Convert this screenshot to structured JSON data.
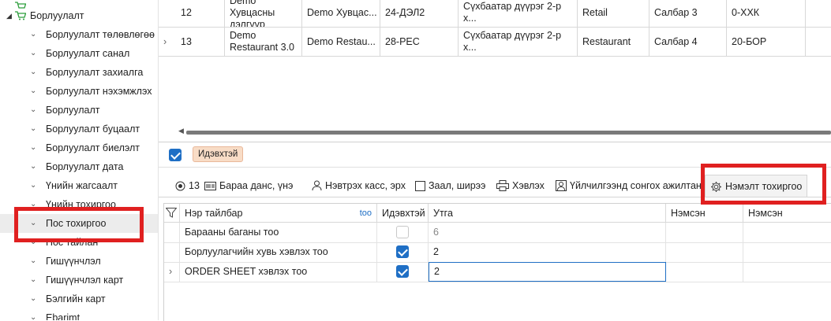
{
  "sidebar": {
    "top_item": "Борлуулалт",
    "items": [
      {
        "label": "Борлуулалт төлөвлөгөө"
      },
      {
        "label": "Борлуулалт санал"
      },
      {
        "label": "Борлуулалт захиалга"
      },
      {
        "label": "Борлуулалт нэхэмжлэх"
      },
      {
        "label": "Борлуулалт"
      },
      {
        "label": "Борлуулалт буцаалт"
      },
      {
        "label": "Борлуулалт биелэлт"
      },
      {
        "label": "Борлуулалт дата"
      },
      {
        "label": "Үнийн жагсаалт"
      },
      {
        "label": "Үнийн тохиргоо"
      },
      {
        "label": "Пос тохиргоо"
      },
      {
        "label": "Пос тайлан"
      },
      {
        "label": "Гишүүнчлэл"
      },
      {
        "label": "Гишүүнчлэл карт"
      },
      {
        "label": "Бэлгийн карт"
      },
      {
        "label": "Ebarimt"
      }
    ]
  },
  "upper_grid": {
    "rows": [
      {
        "expander": "",
        "num": "12",
        "name": "Demo Хувцасны дэлгүүр",
        "short": "Demo Хувцас...",
        "code": "24-ДЭЛ2",
        "address": "Сүхбаатар дүүрэг 2-р х...",
        "type": "Retail",
        "branch": "Салбар 3",
        "extra": "0-ХХК"
      },
      {
        "expander": "›",
        "num": "13",
        "name": "Demo Restaurant 3.0",
        "short": "Demo Restau...",
        "code": "28-PEC",
        "address": "Сүхбаатар дүүрэг 2-р х...",
        "type": "Restaurant",
        "branch": "Салбар 4",
        "extra": "20-БОР"
      }
    ]
  },
  "toolbar": {
    "active_tag": "Идэвхтэй"
  },
  "tabs": [
    {
      "label": "13",
      "icon": "radio-icon"
    },
    {
      "label": "Бараа данс, үнэ",
      "icon": "barcode-icon"
    },
    {
      "label": "Нэвтрэх касс, эрх",
      "icon": "user-icon"
    },
    {
      "label": "Заал, ширээ",
      "icon": "table-icon"
    },
    {
      "label": "Хэвлэх",
      "icon": "printer-icon"
    },
    {
      "label": "Үйлчилгээнд сонгох ажилтан",
      "icon": "staff-icon"
    },
    {
      "label": "Нэмэлт тохиргоо",
      "icon": "gear-icon"
    }
  ],
  "lower_grid": {
    "headers": {
      "name": "Нэр тайлбар",
      "add": "too",
      "active": "Идэвхтэй",
      "value": "Утга",
      "col5": "Нэмсэн",
      "col6": "Нэмсэн"
    },
    "rows": [
      {
        "expander": "",
        "name": "Барааны баганы тоо",
        "active": false,
        "value": "6"
      },
      {
        "expander": "",
        "name": "Борлуулагчийн хувь хэвлэх тоо",
        "active": true,
        "value": "2"
      },
      {
        "expander": "›",
        "name": "ORDER SHEET хэвлэх тоо",
        "active": true,
        "value": "2"
      }
    ]
  },
  "colors": {
    "highlight": "#e02020",
    "accent": "#1f6fc5",
    "tag_bg": "#f8dcc6"
  }
}
